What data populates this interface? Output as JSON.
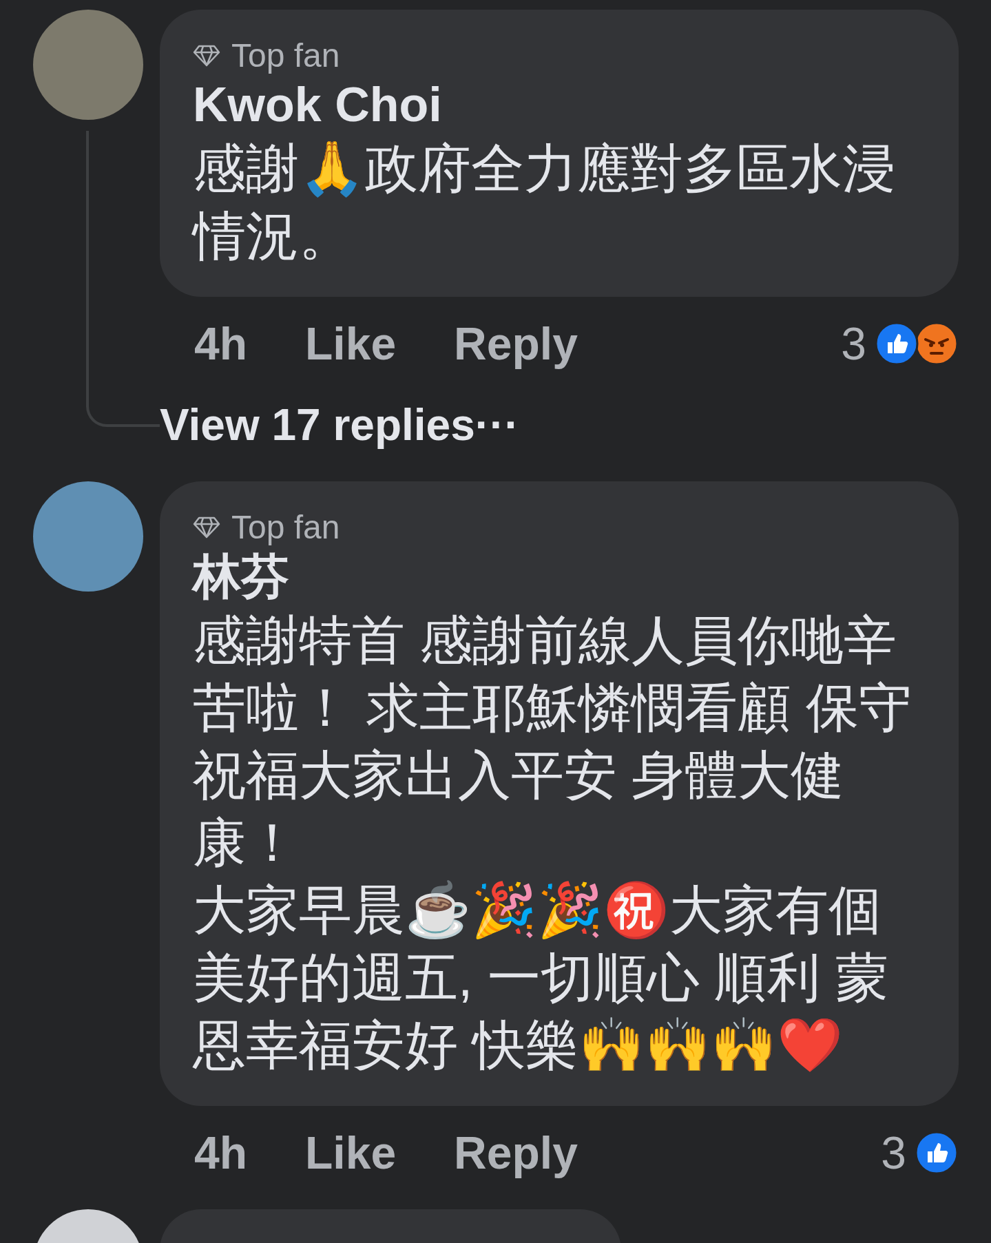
{
  "comments": [
    {
      "badge": "Top fan",
      "author": "Kwok Choi",
      "body": [
        "感謝🙏政府全力應對多區水浸情況。"
      ],
      "time": "4h",
      "actions": [
        "Like",
        "Reply"
      ],
      "reaction_count": "3",
      "reactions": [
        {
          "kind": "like"
        },
        {
          "kind": "angry"
        }
      ],
      "view_replies": "View 17 replies···"
    },
    {
      "badge": "Top fan",
      "author": "林芬",
      "body": [
        "感謝特首 感謝前線人員你哋辛苦啦！ 求主耶穌憐憫看顧 保守祝福大家出入平安 身體大健康！",
        "大家早晨☕🎉🎉㊗️大家有個美好的週五, 一切順心 順利 蒙恩幸福安好 快樂🙌🙌🙌❤️"
      ],
      "time": "4h",
      "actions": [
        "Like",
        "Reply"
      ],
      "reaction_count": "3",
      "reactions": [
        {
          "kind": "like"
        }
      ]
    }
  ]
}
